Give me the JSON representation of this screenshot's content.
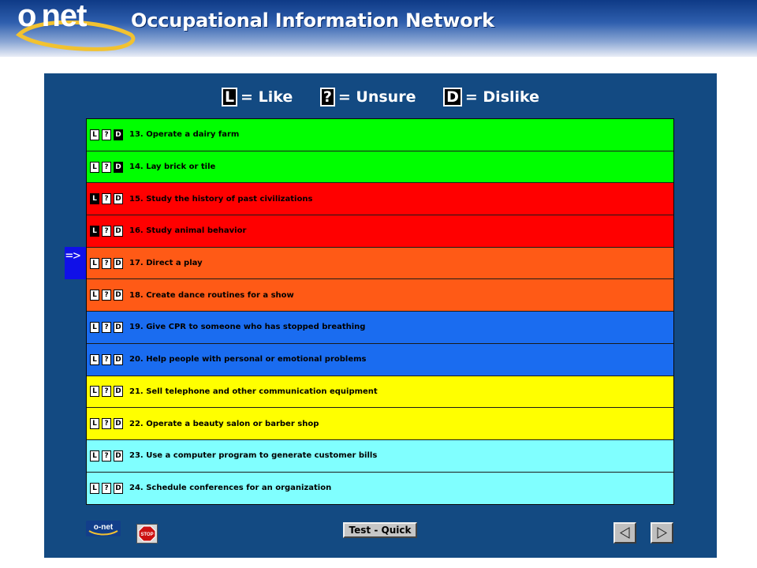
{
  "header": {
    "logo_text": "o net",
    "title": "Occupational Information Network"
  },
  "legend": [
    {
      "key": "L",
      "text": "= Like"
    },
    {
      "key": "?",
      "text": "= Unsure"
    },
    {
      "key": "D",
      "text": "= Dislike"
    }
  ],
  "current_marker": "=>",
  "items": [
    {
      "text": "13. Operate a dairy farm",
      "color": "#00ff00",
      "selected": "D"
    },
    {
      "text": "14. Lay brick or tile",
      "color": "#00ff00",
      "selected": "D"
    },
    {
      "text": "15. Study the history of past civilizations",
      "color": "#ff0000",
      "selected": "L"
    },
    {
      "text": "16. Study animal behavior",
      "color": "#ff0000",
      "selected": "L"
    },
    {
      "text": "17. Direct a play",
      "color": "#ff5a16",
      "selected": ""
    },
    {
      "text": "18. Create dance routines for a show",
      "color": "#ff5a16",
      "selected": ""
    },
    {
      "text": "19. Give CPR to someone who has stopped breathing",
      "color": "#1a6cf0",
      "selected": ""
    },
    {
      "text": "20. Help people with personal or emotional problems",
      "color": "#1a6cf0",
      "selected": ""
    },
    {
      "text": "21. Sell telephone and other communication equipment",
      "color": "#ffff00",
      "selected": ""
    },
    {
      "text": "22. Operate a beauty salon or barber shop",
      "color": "#ffff00",
      "selected": ""
    },
    {
      "text": "23. Use a computer program to generate customer bills",
      "color": "#80ffff",
      "selected": ""
    },
    {
      "text": "24. Schedule conferences for an organization",
      "color": "#80ffff",
      "selected": ""
    }
  ],
  "footer": {
    "mini_logo_text": "o-net",
    "test_button_label": "Test - Quick",
    "stop_icon": "stop-sign-icon",
    "back_icon": "left-arrow-icon",
    "forward_icon": "right-arrow-icon"
  },
  "colors": {
    "panel_background": "#134a82",
    "marker_background": "#1010e8"
  }
}
